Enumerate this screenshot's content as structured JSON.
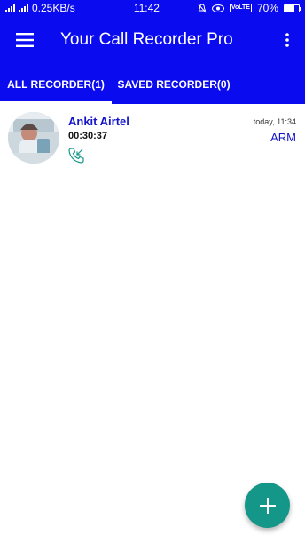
{
  "status_bar": {
    "network_speed": "0.25KB/s",
    "time": "11:42",
    "volte": "VoLTE",
    "battery": "70%",
    "battery_level": 0.7
  },
  "app_bar": {
    "title": "Your Call Recorder Pro",
    "menu_icon": "hamburger-menu-icon",
    "more_icon": "more-vert-icon"
  },
  "tabs": [
    {
      "label": "ALL RECORDER(1)",
      "active": true
    },
    {
      "label": "SAVED RECORDER(0)",
      "active": false
    }
  ],
  "recordings": [
    {
      "name": "Ankit Airtel",
      "duration": "00:30:37",
      "timestamp": "today, 11:34",
      "tag": "ARM",
      "call_type_icon": "incoming-call-icon"
    }
  ],
  "fab": {
    "icon": "plus-icon"
  },
  "colors": {
    "primary": "#0b0bf0",
    "accent": "#149688",
    "contact_text": "#1515c8"
  }
}
